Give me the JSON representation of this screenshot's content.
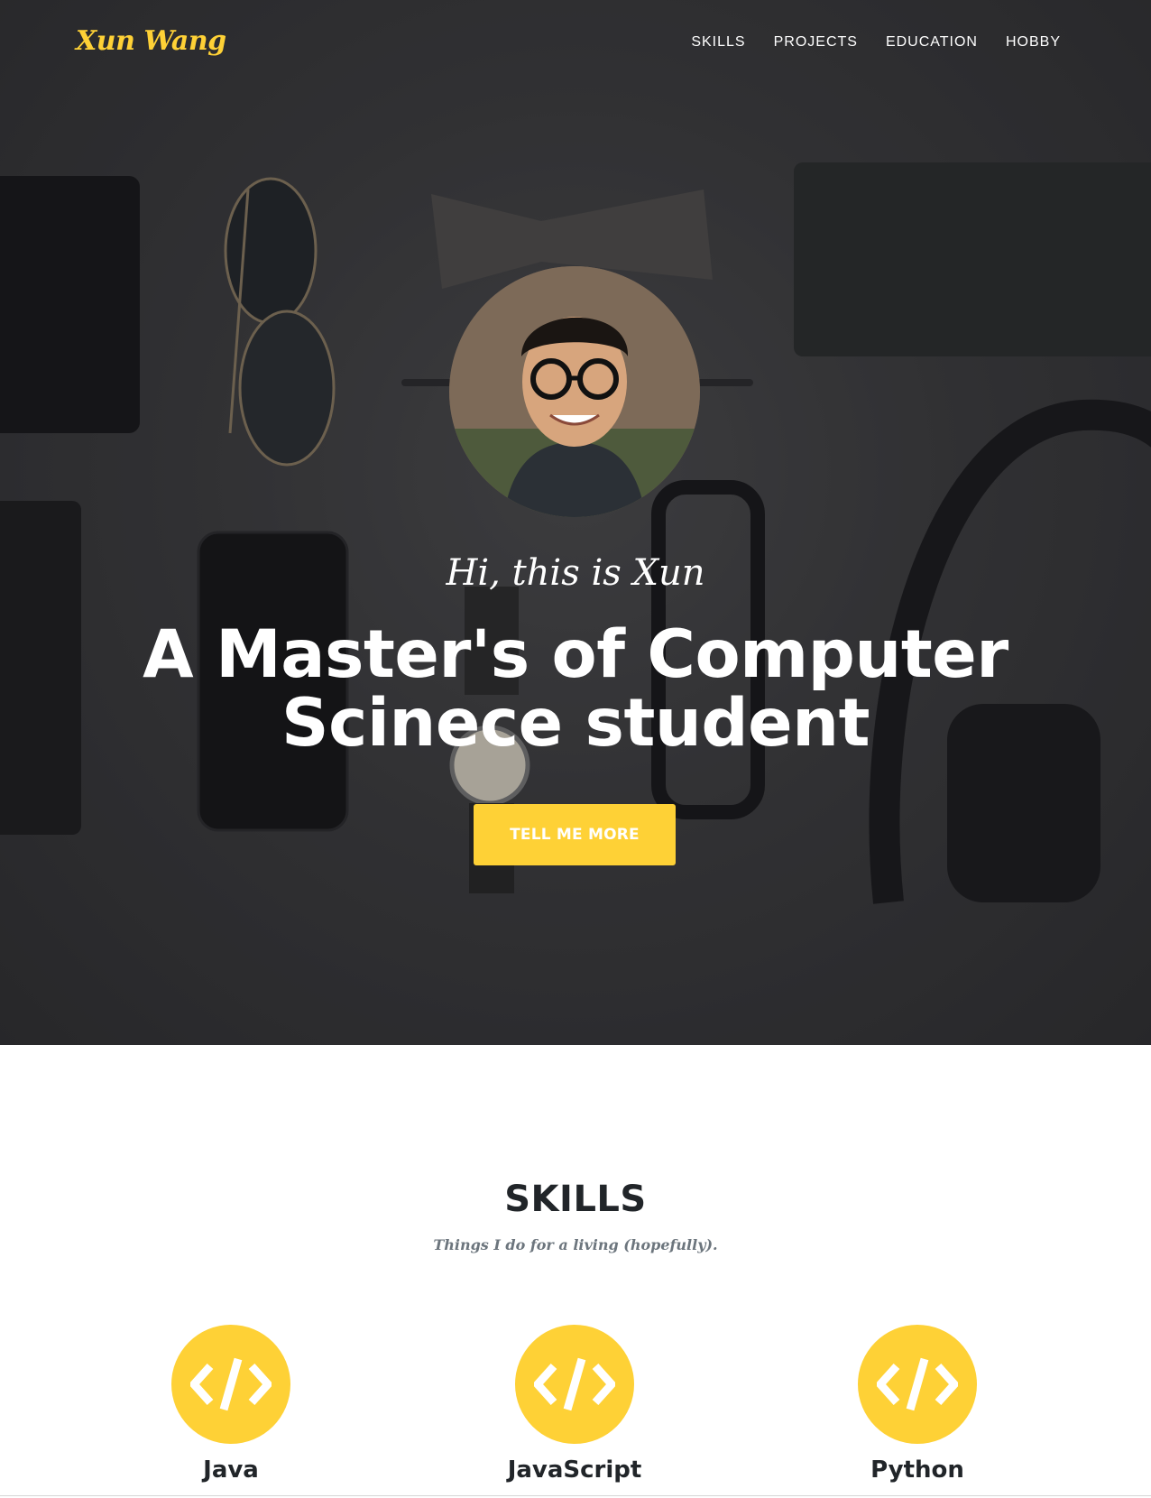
{
  "nav": {
    "brand": "Xun Wang",
    "links": [
      "Skills",
      "Projects",
      "Education",
      "Hobby"
    ]
  },
  "hero": {
    "subheading": "Hi, this is Xun",
    "heading": "A Master's of Computer Scinece student",
    "cta_label": "Tell Me More"
  },
  "skills": {
    "title": "SKILLS",
    "subtitle": "Things I do for a living (hopefully).",
    "items": [
      {
        "name": "Java",
        "icon": "code-icon"
      },
      {
        "name": "JavaScript",
        "icon": "code-icon"
      },
      {
        "name": "Python",
        "icon": "code-icon"
      }
    ]
  },
  "colors": {
    "accent": "#fed136",
    "heading_text": "#212529",
    "muted_text": "#6c757d"
  }
}
